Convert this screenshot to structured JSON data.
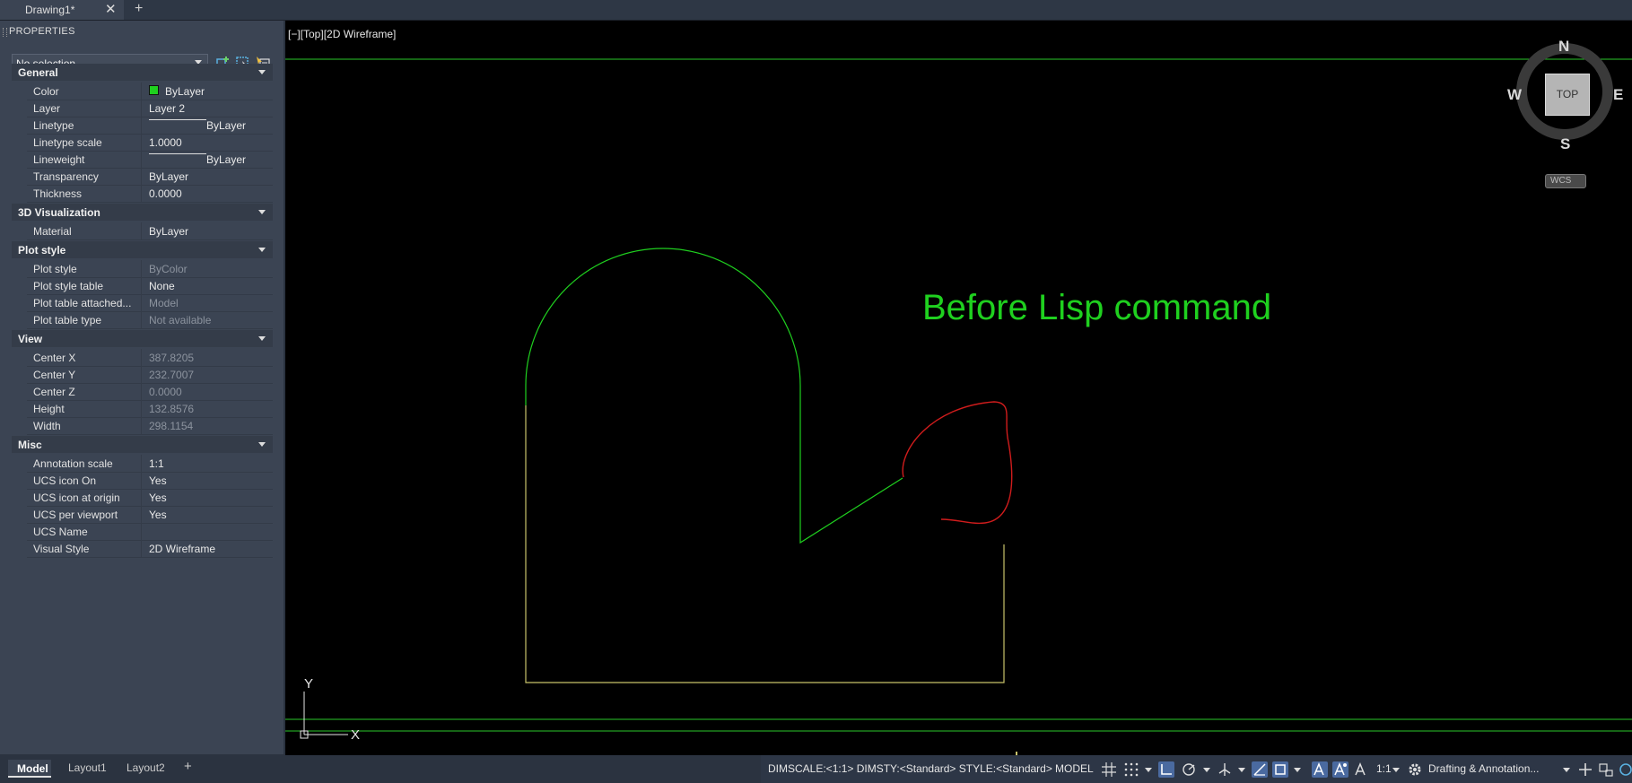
{
  "document_tab": {
    "title": "Drawing1*",
    "close_glyph": "✕",
    "new_tab_glyph": "+"
  },
  "palette": {
    "title": "PROPERTIES",
    "selection": "No selection",
    "sections": [
      {
        "name": "General",
        "rows": [
          {
            "label": "Color",
            "value": "ByLayer",
            "kind": "swatch",
            "swatch_color": "#1fd01f"
          },
          {
            "label": "Layer",
            "value": "Layer 2"
          },
          {
            "label": "Linetype",
            "value": "ByLayer",
            "kind": "line"
          },
          {
            "label": "Linetype scale",
            "value": "1.0000"
          },
          {
            "label": "Lineweight",
            "value": "ByLayer",
            "kind": "line"
          },
          {
            "label": "Transparency",
            "value": "ByLayer"
          },
          {
            "label": "Thickness",
            "value": "0.0000"
          }
        ]
      },
      {
        "name": "3D Visualization",
        "rows": [
          {
            "label": "Material",
            "value": "ByLayer"
          }
        ]
      },
      {
        "name": "Plot style",
        "rows": [
          {
            "label": "Plot style",
            "value": "ByColor",
            "dim": true
          },
          {
            "label": "Plot style table",
            "value": "None"
          },
          {
            "label": "Plot table attached...",
            "value": "Model",
            "dim": true
          },
          {
            "label": "Plot table type",
            "value": "Not available",
            "dim": true
          }
        ]
      },
      {
        "name": "View",
        "rows": [
          {
            "label": "Center X",
            "value": "387.8205",
            "dim": true
          },
          {
            "label": "Center Y",
            "value": "232.7007",
            "dim": true
          },
          {
            "label": "Center Z",
            "value": "0.0000",
            "dim": true
          },
          {
            "label": "Height",
            "value": "132.8576",
            "dim": true
          },
          {
            "label": "Width",
            "value": "298.1154",
            "dim": true
          }
        ]
      },
      {
        "name": "Misc",
        "rows": [
          {
            "label": "Annotation scale",
            "value": "1:1"
          },
          {
            "label": "UCS icon On",
            "value": "Yes"
          },
          {
            "label": "UCS icon at origin",
            "value": "Yes"
          },
          {
            "label": "UCS per viewport",
            "value": "Yes"
          },
          {
            "label": "UCS Name",
            "value": ""
          },
          {
            "label": "Visual Style",
            "value": "2D Wireframe"
          }
        ]
      }
    ]
  },
  "viewport": {
    "label": "[−][Top][2D Wireframe]",
    "annotation_text": "Before Lisp command",
    "annotation_color": "#1fd01f",
    "shape_green_color": "#1fd01f",
    "shape_yellow_color": "#c8c26a",
    "curve_red_color": "#d01c1c",
    "ucs_x_label": "X",
    "ucs_y_label": "Y"
  },
  "viewcube": {
    "top_face": "TOP",
    "north": "N",
    "south": "S",
    "east": "E",
    "west": "W",
    "wcs_label": "WCS"
  },
  "layout_tabs": {
    "model": "Model",
    "layout1": "Layout1",
    "layout2": "Layout2",
    "add": "+"
  },
  "status_bar": {
    "dim_info": "DIMSCALE:<1:1> DIMSTY:<Standard> STYLE:<Standard>",
    "space": "MODEL",
    "scale": "1:1",
    "workspace": "Drafting & Annotation..."
  }
}
